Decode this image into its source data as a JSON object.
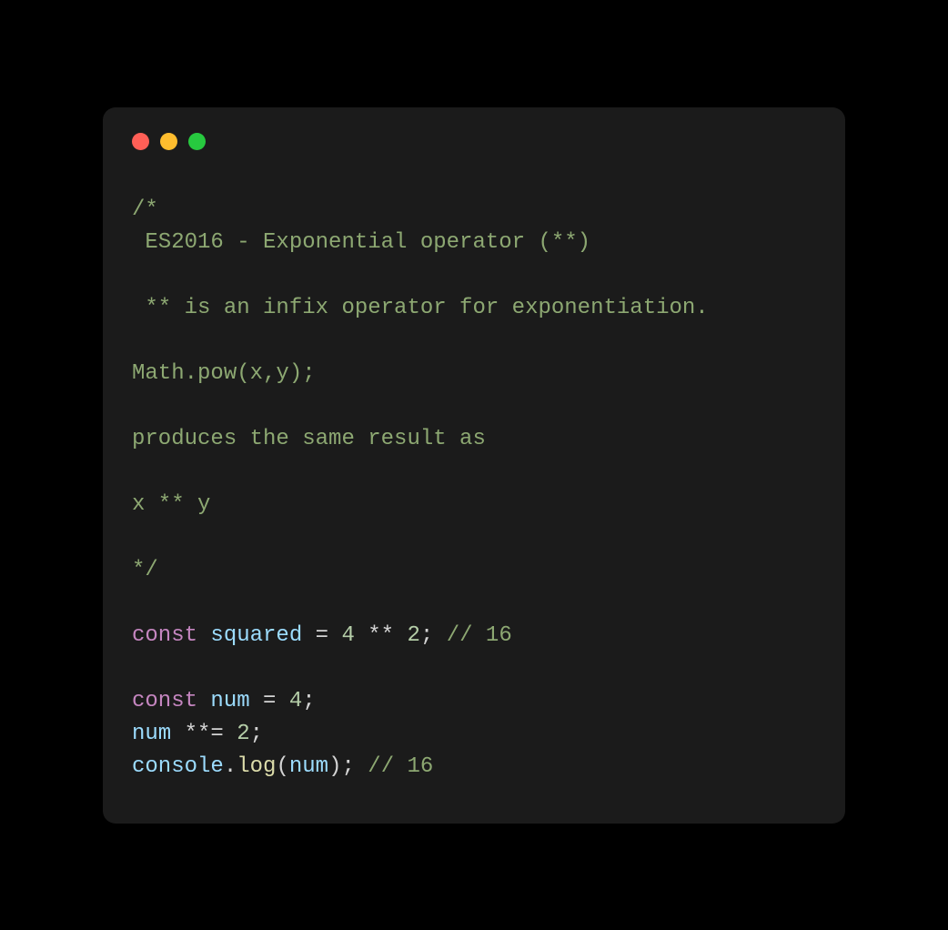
{
  "colors": {
    "comment": "#8da872",
    "keyword": "#c586c0",
    "variable": "#9cdcfe",
    "operator": "#d4d4d4",
    "number": "#b5cea8",
    "func": "#dcdcaa",
    "background": "#1b1b1b",
    "page_background": "#000000",
    "light_close": "#ff5f56",
    "light_minimize": "#ffbd2e",
    "light_zoom": "#27c93f"
  },
  "code": {
    "comment_block": {
      "open": "/*",
      "line1": " ES2016 - Exponential operator (**)",
      "line2": " ** is an infix operator for exponentiation.",
      "line3": "Math.pow(x,y);",
      "line4": "produces the same result as",
      "line5": "x ** y",
      "close": "*/"
    },
    "stmt1": {
      "kw_const": "const",
      "sp1": " ",
      "var_squared": "squared",
      "sp2": " ",
      "eq": "=",
      "sp3": " ",
      "num_4": "4",
      "sp4": " ",
      "op_pow": "**",
      "sp5": " ",
      "num_2": "2",
      "semi": ";",
      "sp6": " ",
      "comment_16": "// 16"
    },
    "stmt2": {
      "kw_const": "const",
      "sp1": " ",
      "var_num": "num",
      "sp2": " ",
      "eq": "=",
      "sp3": " ",
      "num_4": "4",
      "semi": ";"
    },
    "stmt3": {
      "var_num": "num",
      "sp1": " ",
      "op_poweq": "**=",
      "sp2": " ",
      "num_2": "2",
      "semi": ";"
    },
    "stmt4": {
      "obj_console": "console",
      "dot": ".",
      "fn_log": "log",
      "lparen": "(",
      "var_num": "num",
      "rparen": ")",
      "semi": ";",
      "sp1": " ",
      "comment_16": "// 16"
    }
  }
}
